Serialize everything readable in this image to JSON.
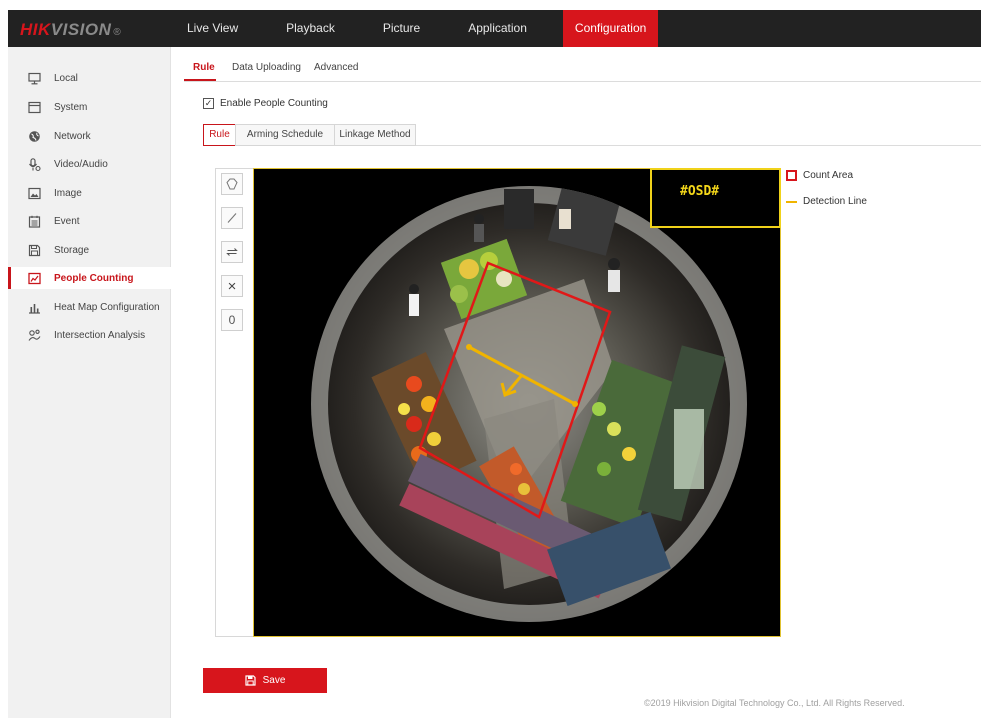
{
  "brand": {
    "logo_red": "HIK",
    "logo_grey": "VISION",
    "logo_mark": "®"
  },
  "nav": {
    "items": [
      "Live View",
      "Playback",
      "Picture",
      "Application",
      "Configuration"
    ],
    "active": "Configuration"
  },
  "sidebar": {
    "items": [
      {
        "label": "Local",
        "icon": "monitor-icon"
      },
      {
        "label": "System",
        "icon": "system-icon"
      },
      {
        "label": "Network",
        "icon": "globe-icon"
      },
      {
        "label": "Video/Audio",
        "icon": "microphone-icon"
      },
      {
        "label": "Image",
        "icon": "image-icon"
      },
      {
        "label": "Event",
        "icon": "calendar-icon"
      },
      {
        "label": "Storage",
        "icon": "storage-icon"
      },
      {
        "label": "People Counting",
        "icon": "people-counting-icon"
      },
      {
        "label": "Heat Map Configuration",
        "icon": "bar-chart-icon"
      },
      {
        "label": "Intersection Analysis",
        "icon": "intersection-icon"
      }
    ],
    "active": "People Counting"
  },
  "tabs": {
    "items": [
      "Rule",
      "Data Uploading",
      "Advanced"
    ],
    "active": "Rule"
  },
  "enable": {
    "label": "Enable People Counting",
    "checked": true,
    "check_glyph": "✓"
  },
  "subtabs": {
    "items": [
      "Rule",
      "Arming Schedule",
      "Linkage Method"
    ],
    "active": "Rule"
  },
  "tools": [
    {
      "icon": "polygon-icon"
    },
    {
      "icon": "draw-line-icon"
    },
    {
      "icon": "swap-direction-icon"
    },
    {
      "icon": "clear-icon",
      "glyph": "×"
    },
    {
      "icon": "zero-icon",
      "glyph": "0"
    }
  ],
  "osd": {
    "text": "#OSD#"
  },
  "legend": {
    "count_area": "Count Area",
    "detection_line": "Detection Line"
  },
  "colors": {
    "accent": "#d7151c",
    "detection_line": "#f0b400",
    "osd": "#f5d81a",
    "topbar": "#222222"
  },
  "save": {
    "label": "Save"
  },
  "footer": {
    "text": "©2019 Hikvision Digital Technology Co., Ltd. All Rights Reserved."
  }
}
